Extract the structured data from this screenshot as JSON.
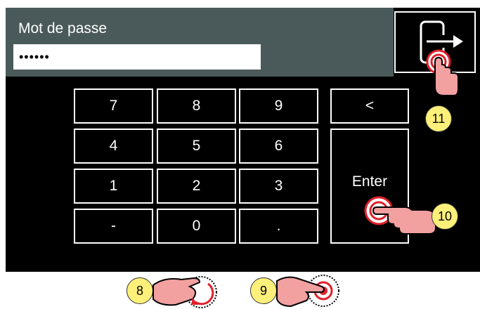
{
  "header": {
    "password_label": "Mot de passe",
    "password_value": "••••••"
  },
  "logout_button": {
    "icon": "logout-arrow-icon"
  },
  "keypad": {
    "keys": [
      "7",
      "8",
      "9",
      "4",
      "5",
      "6",
      "1",
      "2",
      "3",
      "-",
      "0",
      "."
    ],
    "backspace": "<",
    "enter": "Enter"
  },
  "callouts": {
    "logout_step": "11",
    "enter_step": "10",
    "rotate_step": "8",
    "press_step": "9"
  },
  "colors": {
    "header_bg": "#4a5a5a",
    "screen_bg": "#000000",
    "callout_bg": "#fdf07a",
    "target_red": "#e0202a",
    "hand_skin": "#f2a0a0"
  }
}
